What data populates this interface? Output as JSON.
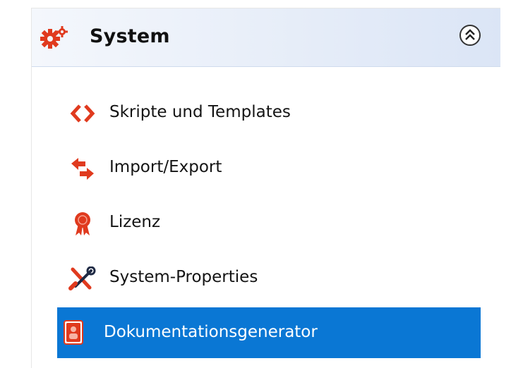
{
  "section": {
    "title": "System",
    "icon": "gears-icon",
    "collapse_icon": "double-chevron-up-icon",
    "header_color": "#dbe5f6"
  },
  "items": [
    {
      "label": "Skripte und Templates",
      "icon": "code-brackets-icon",
      "selected": false
    },
    {
      "label": "Import/Export",
      "icon": "import-export-arrows-icon",
      "selected": false
    },
    {
      "label": "Lizenz",
      "icon": "license-award-icon",
      "selected": false
    },
    {
      "label": "System-Properties",
      "icon": "tools-wrench-screwdriver-icon",
      "selected": false
    },
    {
      "label": "Dokumentationsgenerator",
      "icon": "document-generator-icon",
      "selected": true
    }
  ],
  "colors": {
    "icon_red": "#e03a1e",
    "selection_blue": "#0a77d4",
    "text": "#141414"
  }
}
